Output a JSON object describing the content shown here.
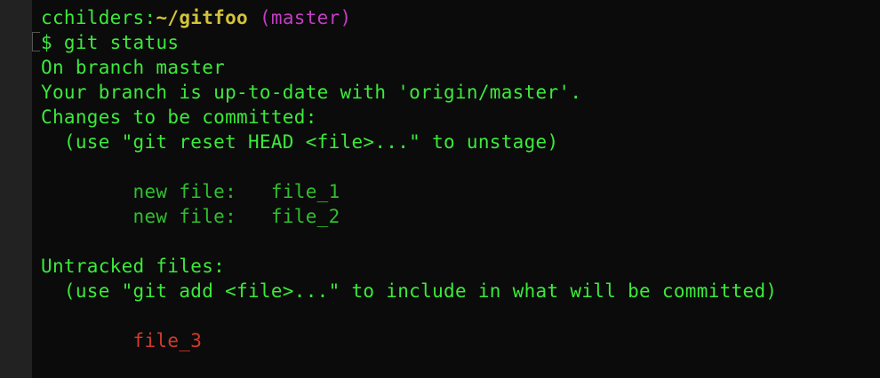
{
  "prompt": {
    "user": "cchilders",
    "separator": ":",
    "path": "~/gitfoo",
    "branch": " (master)"
  },
  "command": {
    "symbol": "$",
    "text": " git status"
  },
  "output": {
    "on_branch": "On branch master",
    "up_to_date": "Your branch is up-to-date with 'origin/master'.",
    "changes_header": "Changes to be committed:",
    "changes_hint": "  (use \"git reset HEAD <file>...\" to unstage)",
    "staged_files": [
      {
        "status": "        new file:   ",
        "name": "file_1"
      },
      {
        "status": "        new file:   ",
        "name": "file_2"
      }
    ],
    "untracked_header": "Untracked files:",
    "untracked_hint": "  (use \"git add <file>...\" to include in what will be committed)",
    "untracked_files": [
      {
        "indent": "        ",
        "name": "file_3"
      }
    ]
  },
  "colors": {
    "prompt_green": "#3bea3b",
    "path_yellow": "#d2c23a",
    "branch_magenta": "#c43cc4",
    "staged_green": "#2fbf2f",
    "untracked_red": "#d33a2c",
    "background": "#0b0b0b"
  }
}
